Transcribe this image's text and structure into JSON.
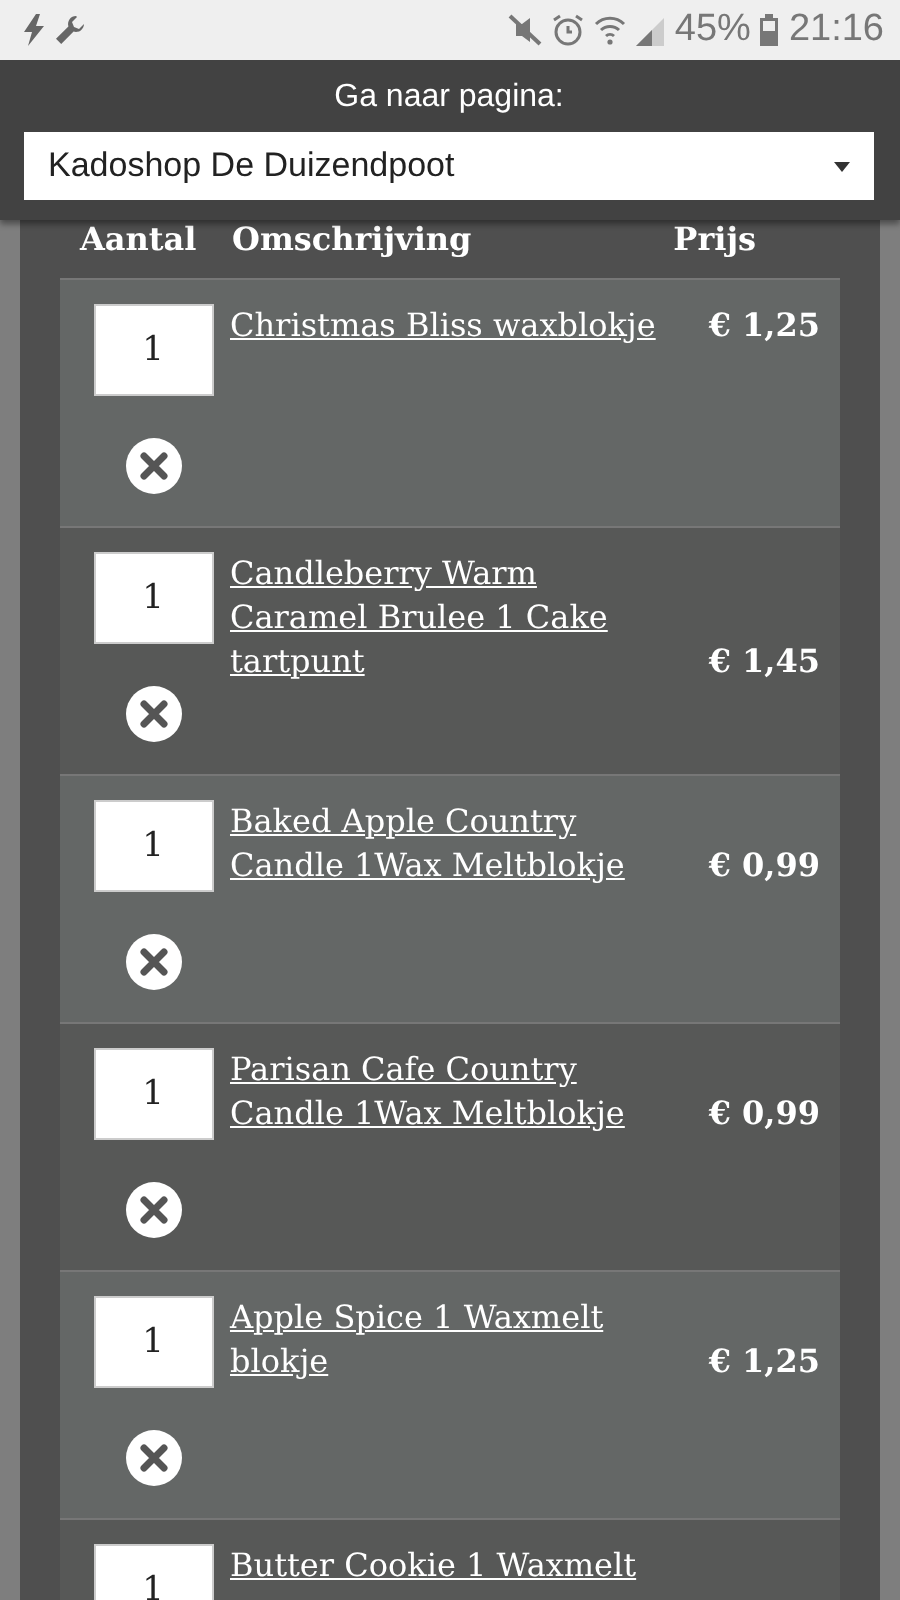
{
  "status_bar": {
    "battery": "45%",
    "time": "21:16"
  },
  "header": {
    "label": "Ga naar pagina:",
    "select": {
      "value": "Kadoshop De Duizendpoot"
    }
  },
  "table": {
    "columns": [
      "Aantal",
      "Omschrijving",
      "Prijs"
    ],
    "rows": [
      {
        "quantity": "1",
        "name": "Christmas Bliss waxblokje",
        "price": "€ 1,25"
      },
      {
        "quantity": "1",
        "name": "Candleberry Warm Caramel Brulee 1 Cake tartpunt",
        "price": "€ 1,45"
      },
      {
        "quantity": "1",
        "name": "Baked Apple Country Candle 1Wax Meltblokje",
        "price": "€ 0,99"
      },
      {
        "quantity": "1",
        "name": "Parisan Cafe Country Candle 1Wax Meltblokje",
        "price": "€ 0,99"
      },
      {
        "quantity": "1",
        "name": "Apple Spice 1 Waxmelt blokje",
        "price": "€ 1,25"
      },
      {
        "quantity": "1",
        "name": "Butter Cookie 1 Waxmelt"
      }
    ]
  }
}
